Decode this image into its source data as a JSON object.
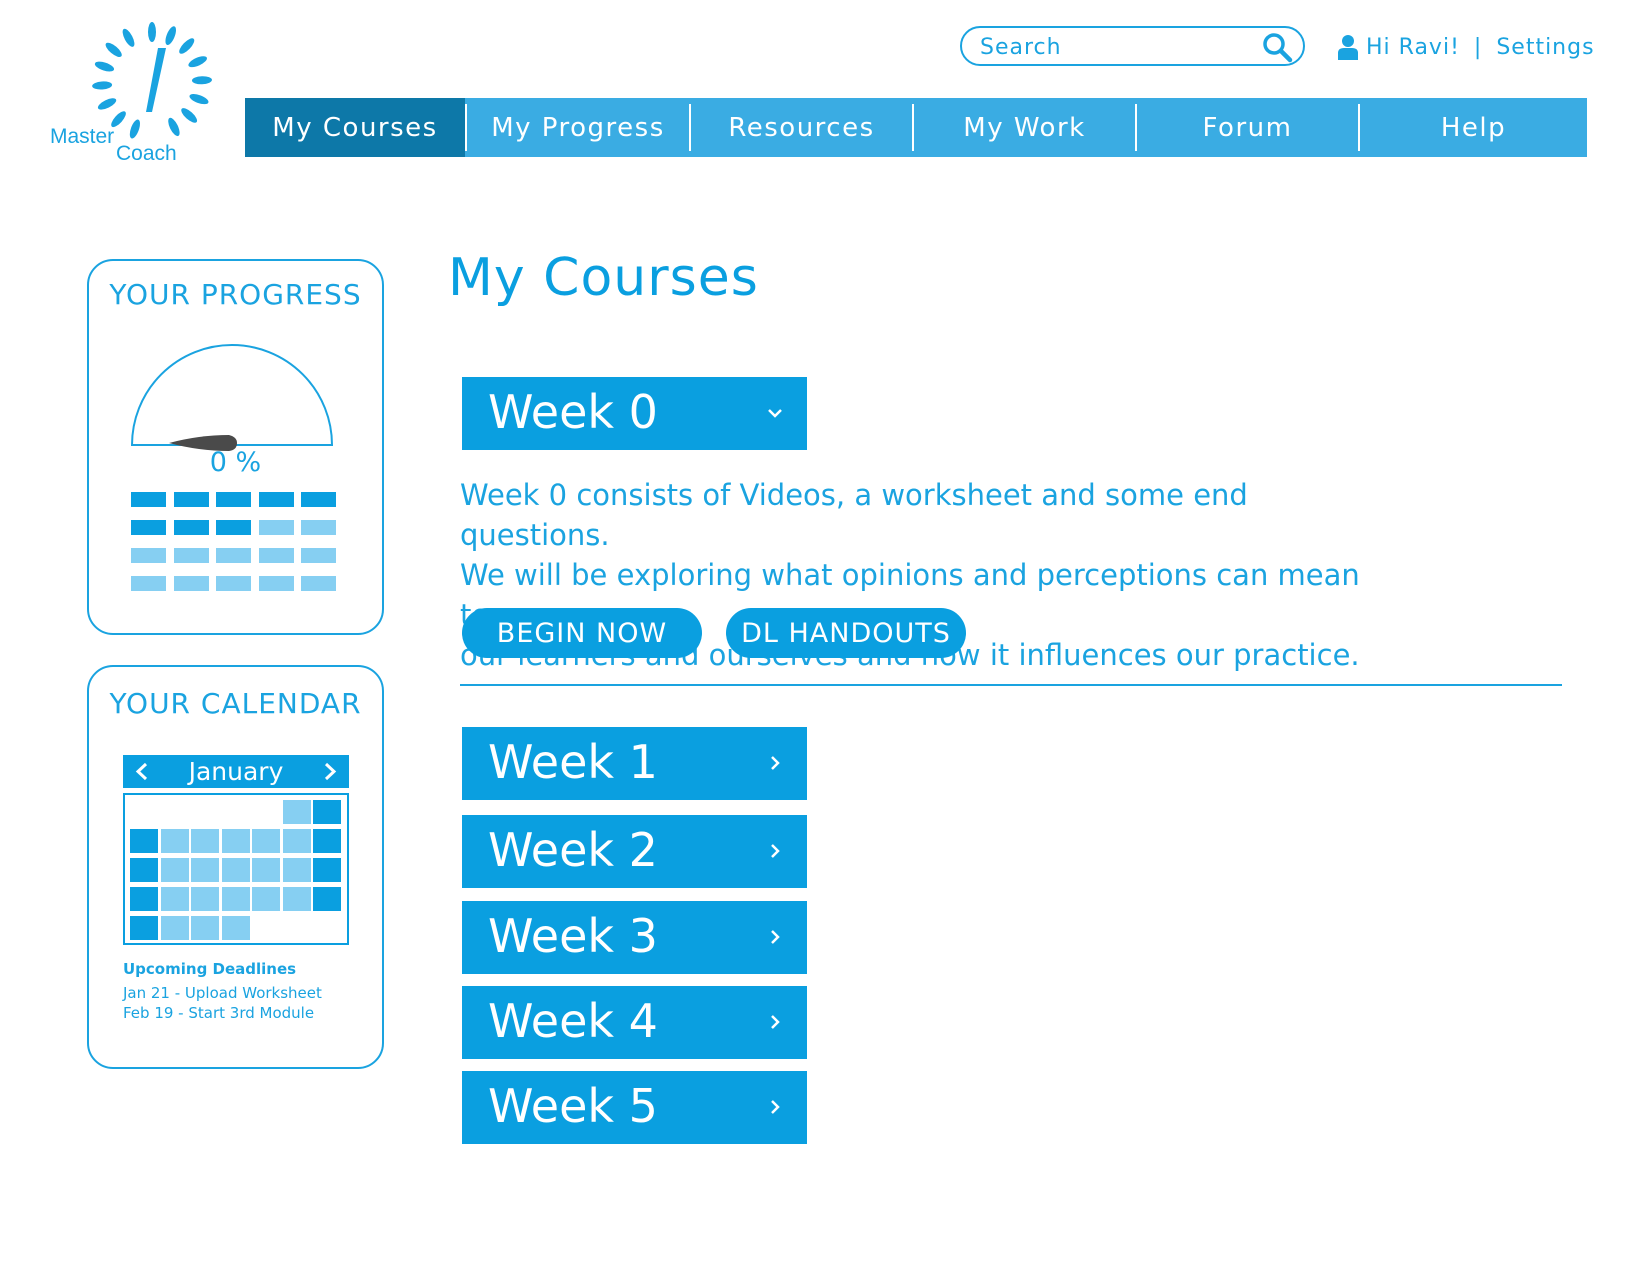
{
  "logo": {
    "line1": "Master",
    "line2": "Coach"
  },
  "search": {
    "placeholder": "Search"
  },
  "user": {
    "greeting": "Hi Ravi!",
    "separator": "|",
    "settings": "Settings"
  },
  "nav": {
    "items": [
      {
        "label": "My Courses",
        "active": true
      },
      {
        "label": "My Progress"
      },
      {
        "label": "Resources"
      },
      {
        "label": "My Work"
      },
      {
        "label": "Forum"
      },
      {
        "label": "Help"
      }
    ]
  },
  "progress": {
    "title": "YOUR PROGRESS",
    "percent_label": "0 %",
    "value": 0
  },
  "calendar": {
    "title": "YOUR CALENDAR",
    "month": "January",
    "deadlines_title": "Upcoming Deadlines",
    "deadlines": [
      "Jan 21 - Upload Worksheet",
      "Feb 19 - Start 3rd Module"
    ]
  },
  "main": {
    "title": "My Courses",
    "weeks": [
      {
        "label": "Week 0",
        "expanded": true
      },
      {
        "label": "Week 1"
      },
      {
        "label": "Week 2"
      },
      {
        "label": "Week 3"
      },
      {
        "label": "Week 4"
      },
      {
        "label": "Week 5"
      }
    ],
    "week0_description": [
      "Week 0 consists of Videos, a worksheet and some end questions.",
      "We will be exploring what opinions and perceptions can mean to",
      "our learners and ourselves and how it influences our practice."
    ],
    "begin_label": "BEGIN NOW",
    "handouts_label": "DL HANDOUTS"
  },
  "colors": {
    "primary": "#0a9fe0",
    "nav": "#3aace3",
    "nav_active": "#0d78a8",
    "light": "#86cff2"
  }
}
